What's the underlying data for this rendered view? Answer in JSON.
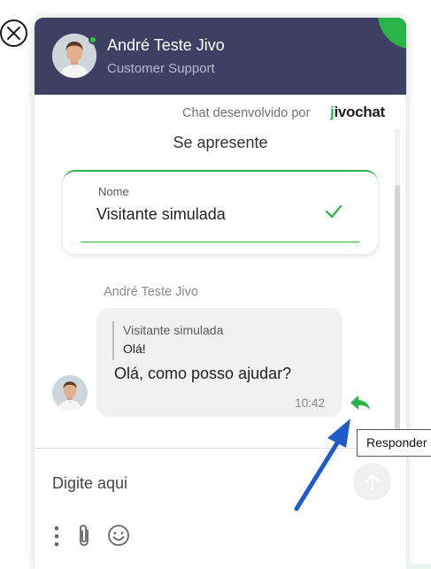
{
  "header": {
    "agent_name": "André Teste Jivo",
    "agent_role": "Customer Support",
    "status": "online"
  },
  "branding": {
    "powered_by": "Chat desenvolvido por",
    "brand_name": "jivochat",
    "brand_first_letter": "j",
    "brand_rest": "ivochat"
  },
  "intro_form": {
    "title": "Se apresente",
    "field_label": "Nome",
    "field_value": "Visitante simulada",
    "valid_icon": "check-icon"
  },
  "message": {
    "sender": "André Teste Jivo",
    "quote_name": "Visitante simulada",
    "quote_text": "Olá!",
    "text": "Olá, como posso ajudar?",
    "time": "10:42"
  },
  "composer": {
    "placeholder": "Digite aqui",
    "send_icon": "arrow-up-icon",
    "tools": [
      "more-icon",
      "paperclip-icon",
      "smiley-icon"
    ]
  },
  "tooltip": {
    "label": "Responder"
  },
  "colors": {
    "header_bg": "#3d4063",
    "accent_green": "#28b446",
    "annotation_arrow": "#1f5cc9"
  }
}
